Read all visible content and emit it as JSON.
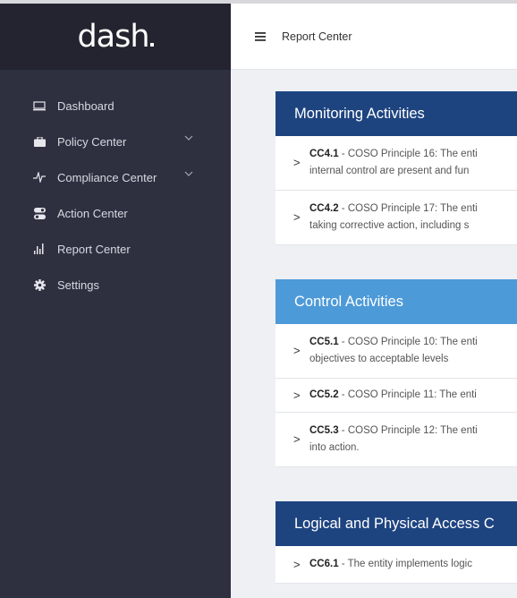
{
  "app": {
    "logo": "dash"
  },
  "sidebar": {
    "items": [
      {
        "label": "Dashboard",
        "icon": "monitor-icon",
        "has_submenu": false
      },
      {
        "label": "Policy Center",
        "icon": "briefcase-icon",
        "has_submenu": true
      },
      {
        "label": "Compliance Center",
        "icon": "pulse-icon",
        "has_submenu": true
      },
      {
        "label": "Action Center",
        "icon": "toggle-icon",
        "has_submenu": false
      },
      {
        "label": "Report Center",
        "icon": "bar-chart-icon",
        "has_submenu": false
      },
      {
        "label": "Settings",
        "icon": "gear-icon",
        "has_submenu": false
      }
    ]
  },
  "header": {
    "title": "Report Center",
    "menu_icon": "hamburger-icon"
  },
  "sections": [
    {
      "title": "Monitoring Activities",
      "color": "#1e4480",
      "items": [
        {
          "code": "CC4.1",
          "line1": " - COSO Principle 16: The enti",
          "line2": "internal control are present and fun"
        },
        {
          "code": "CC4.2",
          "line1": " - COSO Principle 17: The enti",
          "line2": "taking corrective action, including s"
        }
      ]
    },
    {
      "title": "Control Activities",
      "color": "#4d9ad8",
      "items": [
        {
          "code": "CC5.1",
          "line1": " - COSO Principle 10: The enti",
          "line2": "objectives to acceptable levels"
        },
        {
          "code": "CC5.2",
          "line1": " - COSO Principle 11: The enti",
          "line2": ""
        },
        {
          "code": "CC5.3",
          "line1": " - COSO Principle 12: The enti",
          "line2": "into action."
        }
      ]
    },
    {
      "title": "Logical and Physical Access C",
      "color": "#1e4480",
      "items": [
        {
          "code": "CC6.1",
          "line1": " - The entity implements logic",
          "line2": ""
        }
      ]
    }
  ]
}
